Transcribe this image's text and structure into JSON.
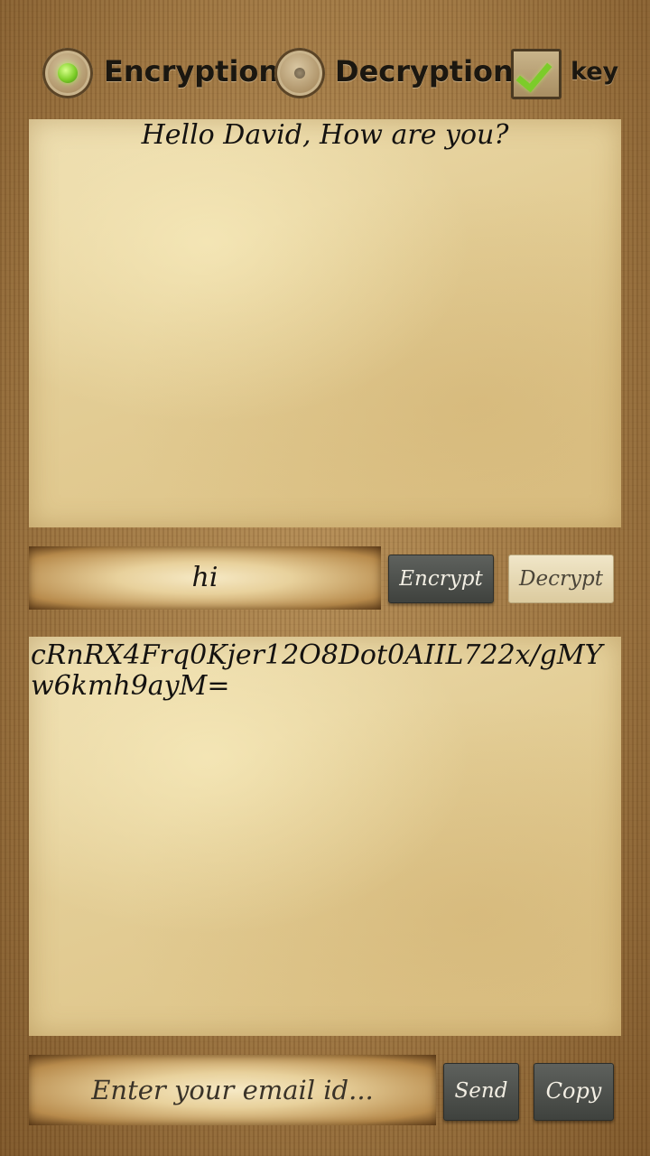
{
  "options": {
    "encryption_label": "Encryption",
    "decryption_label": "Decryption",
    "key_label": "key",
    "selected": "Encryption",
    "key_checked": true
  },
  "plain_text": "Hello David,  How are you?",
  "key_input": {
    "value": "hi"
  },
  "buttons": {
    "encrypt": "Encrypt",
    "decrypt": "Decrypt",
    "send": "Send",
    "copy": "Copy"
  },
  "cipher_text": "cRnRX4Frq0Kjer12O8Dot0AIIL722x/gMYw6kmh9ayM=",
  "email_input": {
    "placeholder": "Enter your email id..."
  },
  "colors": {
    "selected_radio": "#7fcf2a",
    "check_mark": "#7ccc2a",
    "dark_button": "#4a4d49"
  }
}
